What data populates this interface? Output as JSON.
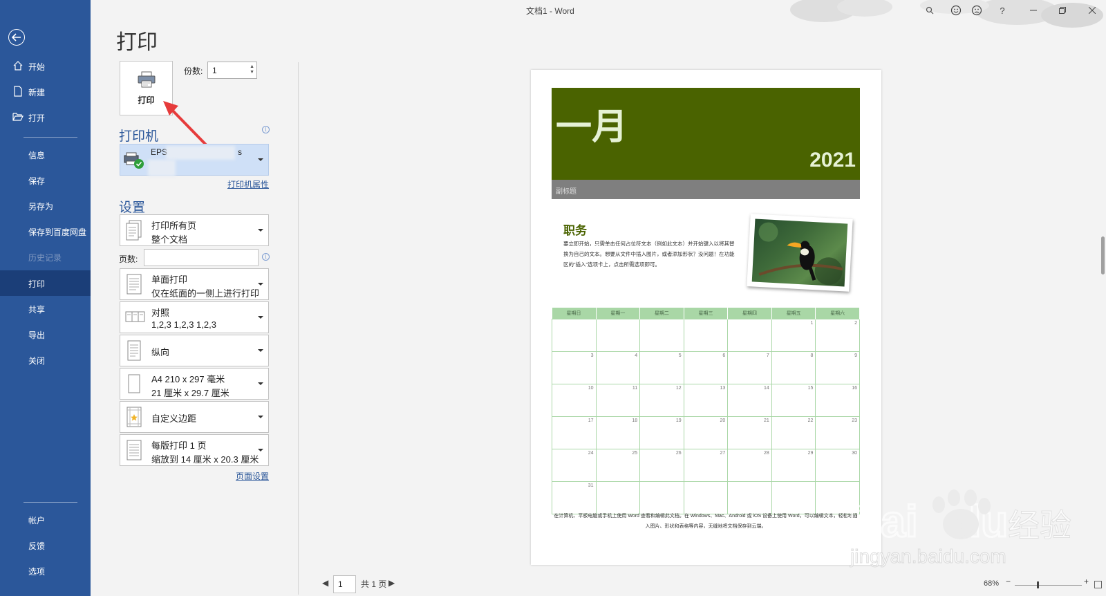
{
  "window": {
    "title": "文档1  -  Word"
  },
  "sidebar": {
    "items": [
      {
        "label": "开始"
      },
      {
        "label": "新建"
      },
      {
        "label": "打开"
      },
      {
        "label": "信息"
      },
      {
        "label": "保存"
      },
      {
        "label": "另存为"
      },
      {
        "label": "保存到百度网盘"
      },
      {
        "label": "历史记录"
      },
      {
        "label": "打印"
      },
      {
        "label": "共享"
      },
      {
        "label": "导出"
      },
      {
        "label": "关闭"
      },
      {
        "label": "帐户"
      },
      {
        "label": "反馈"
      },
      {
        "label": "选项"
      }
    ]
  },
  "print": {
    "title": "打印",
    "button_label": "打印",
    "copies_label": "份数:",
    "copies_value": "1",
    "printer_head": "打印机",
    "printer_name_start": "EPS",
    "printer_name_end": "s",
    "printer_props": "打印机属性",
    "settings_head": "设置",
    "pages_label": "页数:",
    "pages_value": "",
    "page_setup": "页面设置",
    "settings": [
      {
        "line1": "打印所有页",
        "line2": "整个文档"
      },
      {
        "line1": "单面打印",
        "line2": "仅在纸面的一侧上进行打印"
      },
      {
        "line1": "对照",
        "line2": "1,2,3    1,2,3    1,2,3"
      },
      {
        "line1": "纵向",
        "line2": ""
      },
      {
        "line1": "A4 210 x 297 毫米",
        "line2": "21 厘米 x 29.7 厘米"
      },
      {
        "line1": "自定义边距",
        "line2": ""
      },
      {
        "line1": "每版打印 1 页",
        "line2": "缩放到 14 厘米 x 20.3 厘米"
      }
    ]
  },
  "preview": {
    "month": "一月",
    "year": "2021",
    "subtitle": "副标题",
    "duty_title": "职务",
    "duty_text": "要立即开始，只需单击任何占位符文本（例如此文本）并开始键入以将其替换为自己的文本。想要从文件中插入图片，或者添加形状？没问题！在功能区的“插入”选项卡上，点击所需选项即可。",
    "weekdays": [
      "星期日",
      "星期一",
      "星期二",
      "星期三",
      "星期四",
      "星期五",
      "星期六"
    ],
    "weeks": [
      [
        "",
        "",
        "",
        "",
        "",
        "1",
        "2"
      ],
      [
        "3",
        "4",
        "5",
        "6",
        "7",
        "8",
        "9"
      ],
      [
        "10",
        "11",
        "12",
        "13",
        "14",
        "15",
        "16"
      ],
      [
        "17",
        "18",
        "19",
        "20",
        "21",
        "22",
        "23"
      ],
      [
        "24",
        "25",
        "26",
        "27",
        "28",
        "29",
        "30"
      ],
      [
        "31",
        "",
        "",
        "",
        "",
        "",
        ""
      ]
    ],
    "footer": "在计算机、平板电脑或手机上使用 Word 查看和编辑此文档。在 Windows、Mac、Android 或 iOS 设备上使用 Word，可以编辑文本，轻松地插入图片、形状和表格等内容，无缝地将文档保存到云端。"
  },
  "statusbar": {
    "page_value": "1",
    "page_total": "共 1 页",
    "zoom": "68%"
  },
  "watermark": {
    "brand": "Bai",
    "brand2": "du",
    "cn": "经验",
    "url": "jingyan.baidu.com"
  },
  "colors": {
    "sidebar": "#2b579a",
    "banner": "#4a6300",
    "calendar_header": "#a9d7a6"
  }
}
